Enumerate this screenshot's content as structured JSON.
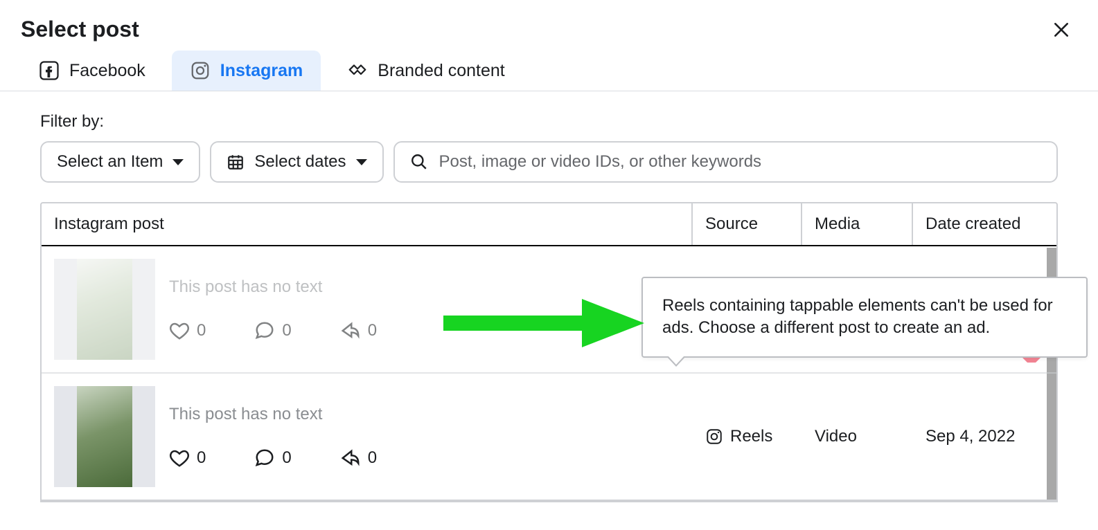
{
  "header": {
    "title": "Select post"
  },
  "tabs": [
    {
      "id": "facebook",
      "label": "Facebook",
      "active": false
    },
    {
      "id": "instagram",
      "label": "Instagram",
      "active": true
    },
    {
      "id": "branded",
      "label": "Branded content",
      "active": false
    }
  ],
  "filters": {
    "label": "Filter by:",
    "item_select_label": "Select an Item",
    "date_select_label": "Select dates",
    "search_placeholder": "Post, image or video IDs, or other keywords"
  },
  "table": {
    "columns": {
      "post": "Instagram post",
      "source": "Source",
      "media": "Media",
      "date": "Date created"
    },
    "rows": [
      {
        "text_placeholder": "This post has no text",
        "likes": "0",
        "comments": "0",
        "shares": "0",
        "source": "",
        "media": "",
        "date": "",
        "disabled": true
      },
      {
        "text_placeholder": "This post has no text",
        "likes": "0",
        "comments": "0",
        "shares": "0",
        "source": "Reels",
        "media": "Video",
        "date": "Sep 4, 2022",
        "disabled": false
      }
    ]
  },
  "tooltip": {
    "text": "Reels containing tappable elements can't be used for ads. Choose a different post to create an ad."
  }
}
